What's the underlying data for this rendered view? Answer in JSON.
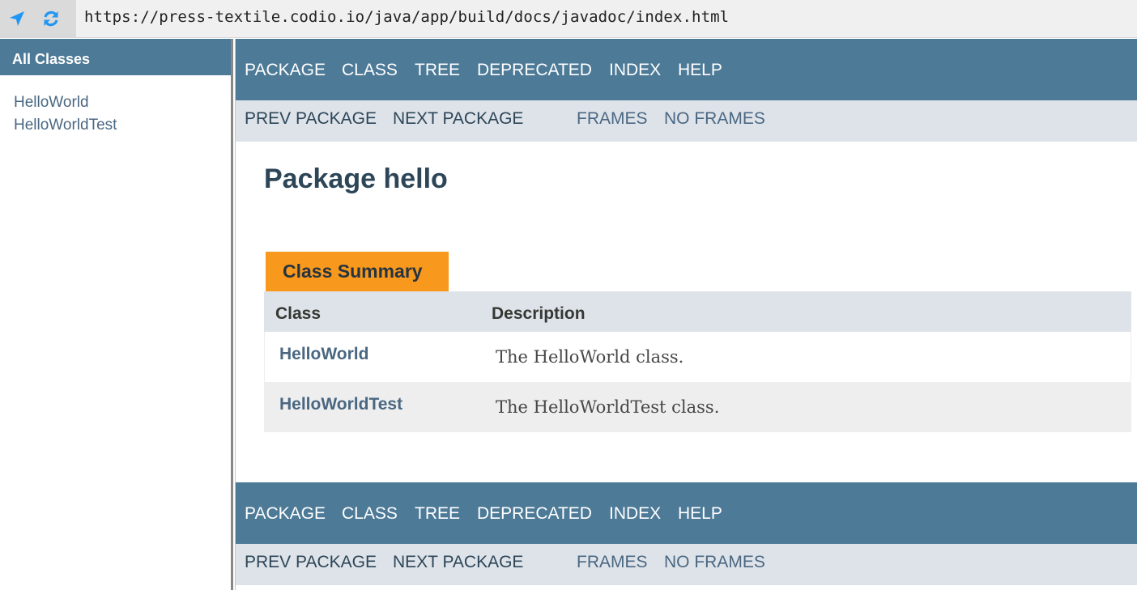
{
  "address_bar": {
    "url": "https://press-textile.codio.io/java/app/build/docs/javadoc/index.html",
    "nav_icon": "location-arrow-icon",
    "reload_icon": "refresh-icon"
  },
  "left_frame": {
    "header": "All Classes",
    "classes": [
      "HelloWorld",
      "HelloWorldTest"
    ]
  },
  "top_nav": {
    "items": [
      "PACKAGE",
      "CLASS",
      "TREE",
      "DEPRECATED",
      "INDEX",
      "HELP"
    ]
  },
  "sub_nav": {
    "prev": "PREV PACKAGE",
    "next": "NEXT PACKAGE",
    "frames": "FRAMES",
    "no_frames": "NO FRAMES"
  },
  "content": {
    "title": "Package hello",
    "summary_tab": "Class Summary",
    "columns": [
      "Class",
      "Description"
    ],
    "rows": [
      {
        "class": "HelloWorld",
        "description": "The HelloWorld class."
      },
      {
        "class": "HelloWorldTest",
        "description": "The HelloWorldTest class."
      }
    ]
  },
  "colors": {
    "nav_bg": "#4d7a97",
    "subnav_bg": "#dee3e9",
    "tab_bg": "#f8981d",
    "link": "#4a6782"
  }
}
